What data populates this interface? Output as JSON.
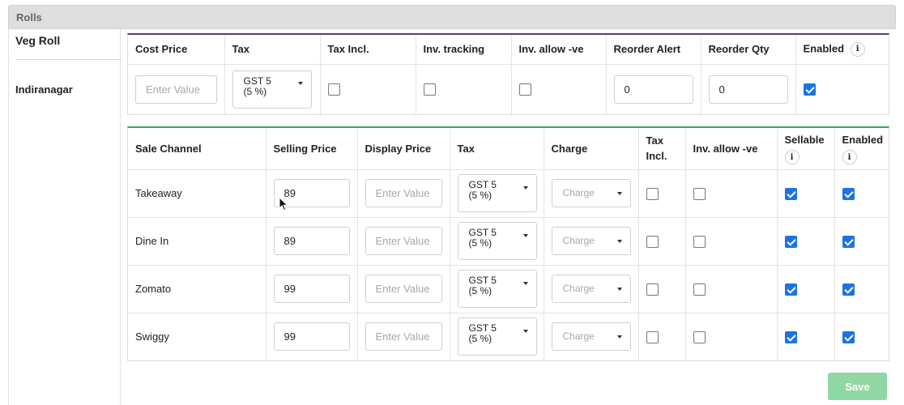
{
  "section": {
    "title": "Rolls"
  },
  "item": {
    "name": "Veg Roll",
    "location": "Indiranagar"
  },
  "inventory_table": {
    "headers": {
      "cost_price": "Cost Price",
      "tax": "Tax",
      "tax_incl": "Tax Incl.",
      "inv_tracking": "Inv. tracking",
      "inv_allow_neg": "Inv. allow -ve",
      "reorder_alert": "Reorder Alert",
      "reorder_qty": "Reorder Qty",
      "enabled": "Enabled"
    },
    "row": {
      "cost_price_placeholder": "Enter Value",
      "tax_line1": "GST 5",
      "tax_line2": "(5 %)",
      "tax_incl": false,
      "inv_tracking": false,
      "inv_allow_neg": false,
      "reorder_alert": "0",
      "reorder_qty": "0",
      "enabled": true
    }
  },
  "channels_table": {
    "headers": {
      "sale_channel": "Sale Channel",
      "selling_price": "Selling Price",
      "display_price": "Display Price",
      "tax": "Tax",
      "charge": "Charge",
      "tax_incl_1": "Tax",
      "tax_incl_2": "Incl.",
      "inv_allow_neg": "Inv. allow -ve",
      "sellable": "Sellable",
      "enabled": "Enabled"
    },
    "rows": [
      {
        "channel": "Takeaway",
        "selling_price": "89",
        "display_placeholder": "Enter Value",
        "tax_line1": "GST 5",
        "tax_line2": "(5 %)",
        "charge_placeholder": "Charge",
        "tax_incl": false,
        "inv_allow_neg": false,
        "sellable": true,
        "enabled": true
      },
      {
        "channel": "Dine In",
        "selling_price": "89",
        "display_placeholder": "Enter Value",
        "tax_line1": "GST 5",
        "tax_line2": "(5 %)",
        "charge_placeholder": "Charge",
        "tax_incl": false,
        "inv_allow_neg": false,
        "sellable": true,
        "enabled": true
      },
      {
        "channel": "Zomato",
        "selling_price": "99",
        "display_placeholder": "Enter Value",
        "tax_line1": "GST 5",
        "tax_line2": "(5 %)",
        "charge_placeholder": "Charge",
        "tax_incl": false,
        "inv_allow_neg": false,
        "sellable": true,
        "enabled": true
      },
      {
        "channel": "Swiggy",
        "selling_price": "99",
        "display_placeholder": "Enter Value",
        "tax_line1": "GST 5",
        "tax_line2": "(5 %)",
        "charge_placeholder": "Charge",
        "tax_incl": false,
        "inv_allow_neg": false,
        "sellable": true,
        "enabled": true
      }
    ]
  },
  "info_icon_glyph": "i",
  "save_label": "Save",
  "colors": {
    "accent_purple": "#5b3a8e",
    "accent_green": "#2fae52",
    "checkbox_blue": "#1a73e8",
    "save_disabled": "#8fd8a4"
  }
}
